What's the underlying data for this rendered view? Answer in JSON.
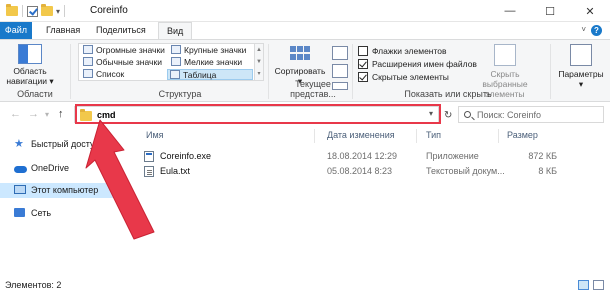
{
  "window": {
    "title": "Coreinfo",
    "controls": {
      "minimize": "—",
      "maximize": "☐",
      "close": "✕"
    },
    "quick_access_dropdown": "▾"
  },
  "tabs": [
    {
      "label": "Файл",
      "active": false
    },
    {
      "label": "Главная",
      "active": false
    },
    {
      "label": "Поделиться",
      "active": false
    },
    {
      "label": "Вид",
      "active": true
    }
  ],
  "ribbon": {
    "panes_group": {
      "nav_pane_label_1": "Область",
      "nav_pane_label_2": "навигации ▾",
      "group_label": "Области"
    },
    "layout_group": {
      "items": [
        "Огромные значки",
        "Обычные значки",
        "Список",
        "Крупные значки",
        "Мелкие значки",
        "Таблица"
      ],
      "selected": "Таблица",
      "group_label": "Структура"
    },
    "current_view_group": {
      "sort_label": "Сортировать",
      "sort_arrow": "▾",
      "group_label": "Текущее представ..."
    },
    "show_hide_group": {
      "checkboxes": [
        {
          "label": "Флажки элементов",
          "checked": false
        },
        {
          "label": "Расширения имен файлов",
          "checked": true
        },
        {
          "label": "Скрытые элементы",
          "checked": true
        }
      ],
      "hide_selected_1": "Скрыть выбранные",
      "hide_selected_2": "элементы",
      "group_label": "Показать или скрыть"
    },
    "options": {
      "label": "Параметры",
      "arrow": "▾"
    }
  },
  "navigation": {
    "back": "←",
    "forward": "→",
    "recent": "▾",
    "up": "↑",
    "address_value": "cmd",
    "address_dropdown": "▾",
    "refresh": "↻",
    "search_placeholder": "Поиск: Coreinfo"
  },
  "sidebar": {
    "items": [
      {
        "label": "Быстрый доступ",
        "icon": "star-icon"
      },
      {
        "label": "OneDrive",
        "icon": "cloud-icon"
      },
      {
        "label": "Этот компьютер",
        "icon": "computer-icon",
        "selected": true
      },
      {
        "label": "Сеть",
        "icon": "network-icon"
      }
    ]
  },
  "file_list": {
    "columns": [
      "Имя",
      "Дата изменения",
      "Тип",
      "Размер"
    ],
    "rows": [
      {
        "name": "Coreinfo.exe",
        "date": "18.08.2014 12:29",
        "type": "Приложение",
        "size": "872 КБ",
        "icon": "exe-icon"
      },
      {
        "name": "Eula.txt",
        "date": "05.08.2014 8:23",
        "type": "Текстовый докум...",
        "size": "8 КБ",
        "icon": "text-file-icon"
      }
    ]
  },
  "status": {
    "items_count": "Элементов: 2"
  },
  "colors": {
    "accent": "#1979ca",
    "highlight_red": "#e8384a",
    "selection": "#cce8ff"
  }
}
